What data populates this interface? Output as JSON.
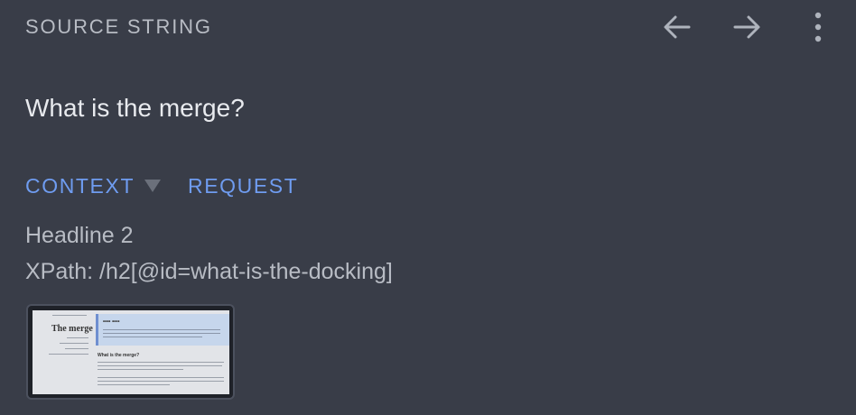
{
  "header": {
    "title": "SOURCE STRING"
  },
  "toolbar": {
    "back_icon": "arrow-left-icon",
    "forward_icon": "arrow-right-icon",
    "menu_icon": "more-vertical-icon"
  },
  "source": {
    "text": "What is the merge?"
  },
  "tabs": [
    {
      "label": "CONTEXT",
      "has_dropdown": true
    },
    {
      "label": "REQUEST"
    }
  ],
  "context": {
    "element_type": "Headline 2",
    "xpath": "XPath: /h2[@id=what-is-the-docking]"
  },
  "screenshot_preview": {
    "title": "The merge",
    "banner_heading": "•••• ••••",
    "section_heading": "What is the merge?"
  },
  "colors": {
    "background": "#393d48",
    "accent": "#6f9cf0",
    "muted_text": "#b8bcc4"
  }
}
